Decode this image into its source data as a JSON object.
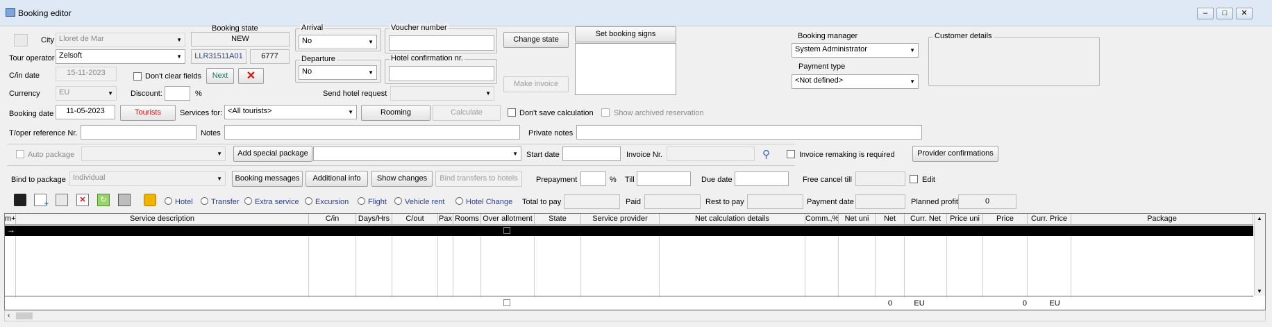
{
  "window": {
    "title": "Booking editor"
  },
  "header": {
    "city_label": "City",
    "city_value": "Lloret de Mar",
    "booking_state_label": "Booking state",
    "booking_state_value": "NEW",
    "tour_operator_label": "Tour operator",
    "tour_operator_value": "Zelsoft",
    "booking_code": "LLR31511A01",
    "booking_number": "6777",
    "cin_date_label": "C/in date",
    "cin_date_value": "15-11-2023",
    "dont_clear_label": "Don't clear fields",
    "next_label": "Next",
    "currency_label": "Currency",
    "currency_value": "EU",
    "discount_label": "Discount:",
    "discount_unit": "%",
    "booking_date_label": "Booking date",
    "booking_date_value": "11-05-2023",
    "tourists_label": "Tourists",
    "services_for_label": "Services for:",
    "services_for_value": "<All tourists>",
    "rooming_label": "Rooming",
    "calculate_label": "Calculate",
    "dont_save_calc_label": "Don't save calculation",
    "show_archived_label": "Show archived reservation",
    "toper_ref_label": "T/oper reference Nr.",
    "notes_label": "Notes",
    "private_notes_label": "Private notes"
  },
  "arrival": {
    "legend": "Arrival",
    "value": "No"
  },
  "departure": {
    "legend": "Departure",
    "value": "No"
  },
  "voucher": {
    "legend": "Voucher number"
  },
  "hotel_conf": {
    "legend": "Hotel confirmation nr."
  },
  "send_hotel_request_label": "Send hotel request",
  "change_state_label": "Change state",
  "make_invoice_label": "Make invoice",
  "set_booking_signs_label": "Set booking signs",
  "manager": {
    "label": "Booking manager",
    "value": "System Administrator",
    "payment_type_label": "Payment type",
    "payment_type_value": "<Not defined>"
  },
  "customer_details_legend": "Customer details",
  "row_package": {
    "auto_package_label": "Auto package",
    "add_special_package_label": "Add special package",
    "start_date_label": "Start date",
    "invoice_nr_label": "Invoice Nr.",
    "invoice_remaking_label": "Invoice remaking is required",
    "provider_confirmations_label": "Provider confirmations"
  },
  "row_bind": {
    "bind_label": "Bind to package",
    "bind_value": "Individual",
    "booking_messages_label": "Booking messages",
    "additional_info_label": "Additional info",
    "show_changes_label": "Show changes",
    "bind_transfers_label": "Bind transfers to hotels",
    "prepayment_label": "Prepayment",
    "prepayment_unit": "%",
    "till_label": "Till",
    "due_date_label": "Due date",
    "free_cancel_label": "Free cancel till",
    "edit_label": "Edit"
  },
  "row_totals": {
    "radios": [
      "Hotel",
      "Transfer",
      "Extra service",
      "Excursion",
      "Flight",
      "Vehicle rent",
      "Hotel Change"
    ],
    "total_to_pay_label": "Total to pay",
    "paid_label": "Paid",
    "rest_to_pay_label": "Rest to pay",
    "payment_date_label": "Payment date",
    "planned_profit_label": "Planned profit",
    "planned_profit_value": "0"
  },
  "toolbar_icons": [
    "save-icon",
    "add-document-icon",
    "copy-icon",
    "delete-icon",
    "refresh-icon",
    "print-icon",
    "lock-icon"
  ],
  "grid": {
    "columns": [
      "m+",
      "Service description",
      "C/in",
      "Days/Hrs",
      "C/out",
      "Pax",
      "Rooms",
      "Over allotment",
      "State",
      "Service provider",
      "Net calculation details",
      "Comm.,%",
      "Net uni",
      "Net",
      "Curr. Net",
      "Price uni",
      "Price",
      "Curr. Price",
      "Package"
    ],
    "row_marker": "→",
    "footer": {
      "net": "0",
      "curr_net": "EU",
      "price": "0",
      "curr_price": "EU"
    }
  }
}
